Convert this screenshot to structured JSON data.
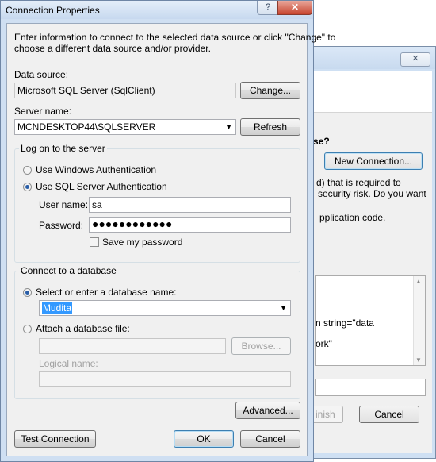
{
  "background_window": {
    "close_icon_glyph": "✕",
    "truncated_question": "se?",
    "new_connection_button": "New Connection...",
    "text_line1": "d) that is required to",
    "text_line2": "security risk. Do you want",
    "text_line3": "pplication code.",
    "box_line1": "n string=\"data",
    "box_line2": "ork\"",
    "finish_button": "inish",
    "cancel_button": "Cancel"
  },
  "dialog": {
    "title": "Connection Properties",
    "help_glyph": "?",
    "close_glyph": "✕",
    "intro_line1": "Enter information to connect to the selected data source or click \"Change\" to",
    "intro_line2": "choose a different data source and/or provider.",
    "data_source_label": "Data source:",
    "data_source_value": "Microsoft SQL Server (SqlClient)",
    "change_button": "Change...",
    "server_name_label": "Server name:",
    "server_name_value": "MCNDESKTOP44\\SQLSERVER",
    "refresh_button": "Refresh",
    "logon_group_label": "Log on to the server",
    "windows_auth_label": "Use Windows Authentication",
    "sql_auth_label": "Use SQL Server Authentication",
    "user_name_label": "User name:",
    "user_name_value": "sa",
    "password_label": "Password:",
    "password_value": "●●●●●●●●●●●●",
    "save_password_label": "Save my password",
    "db_group_label": "Connect to a database",
    "select_db_label": "Select or enter a database name:",
    "db_name_value": "Mudita",
    "attach_db_label": "Attach a database file:",
    "browse_button": "Browse...",
    "logical_name_label": "Logical name:",
    "advanced_button": "Advanced...",
    "test_connection_button": "Test Connection",
    "ok_button": "OK",
    "cancel_button": "Cancel"
  },
  "state": {
    "auth_mode": "sql",
    "save_password": false,
    "db_mode": "select"
  }
}
